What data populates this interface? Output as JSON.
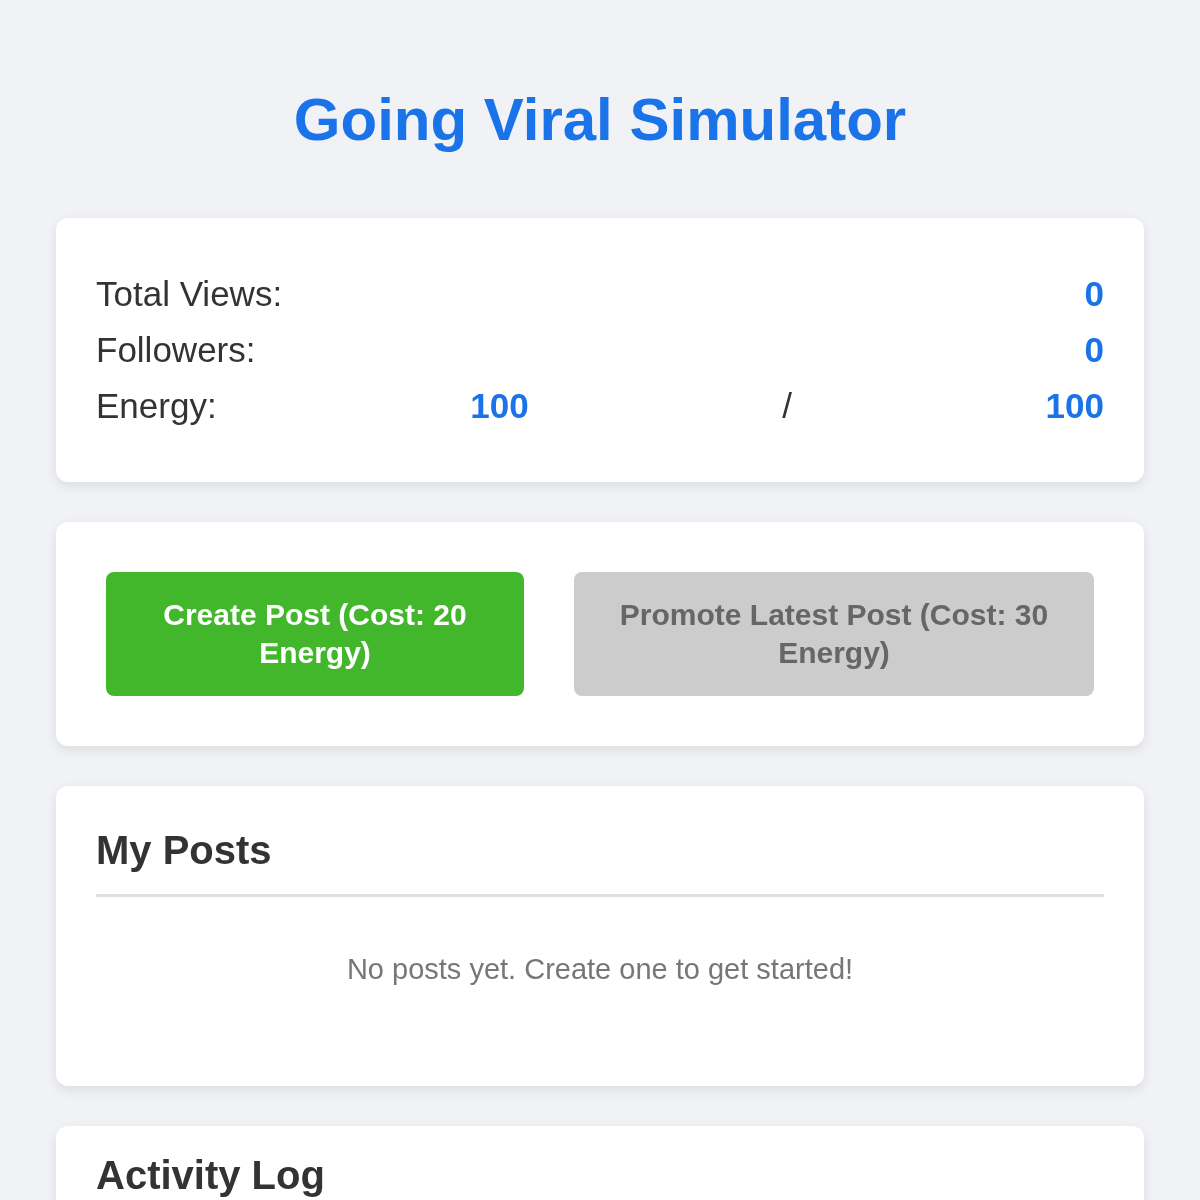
{
  "title": "Going Viral Simulator",
  "stats": [
    {
      "label": "Total Views:",
      "parts": [
        {
          "kind": "value",
          "text": "0"
        }
      ]
    },
    {
      "label": "Followers:",
      "parts": [
        {
          "kind": "value",
          "text": "0"
        }
      ]
    },
    {
      "label": "Energy:",
      "parts": [
        {
          "kind": "value",
          "text": "100"
        },
        {
          "kind": "separator",
          "text": "/"
        },
        {
          "kind": "value",
          "text": "100"
        }
      ]
    }
  ],
  "actions": [
    {
      "label": "Create Post (Cost: 20 Energy)",
      "disabled": false
    },
    {
      "label": "Promote Latest Post (Cost: 30 Energy)",
      "disabled": true
    }
  ],
  "posts": {
    "heading": "My Posts",
    "empty_message": "No posts yet. Create one to get started!"
  },
  "activity_log": {
    "heading": "Activity Log"
  }
}
